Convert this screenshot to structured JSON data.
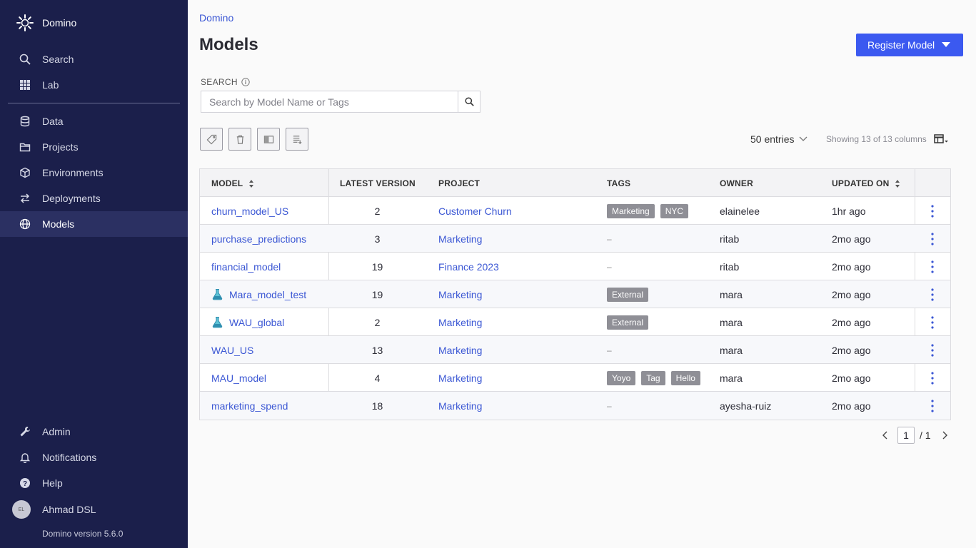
{
  "app": {
    "brand_name": "Domino",
    "version_text": "Domino version 5.6.0"
  },
  "sidebar": {
    "top_items": [
      {
        "label": "Search",
        "icon": "search-icon"
      },
      {
        "label": "Lab",
        "icon": "grid-icon"
      }
    ],
    "main_items": [
      {
        "label": "Data",
        "icon": "database-icon"
      },
      {
        "label": "Projects",
        "icon": "folder-icon"
      },
      {
        "label": "Environments",
        "icon": "cube-icon"
      },
      {
        "label": "Deployments",
        "icon": "arrows-icon"
      },
      {
        "label": "Models",
        "icon": "globe-icon",
        "active": true
      }
    ],
    "bottom_items": [
      {
        "label": "Admin",
        "icon": "wrench-icon"
      },
      {
        "label": "Notifications",
        "icon": "bell-icon"
      },
      {
        "label": "Help",
        "icon": "help-icon"
      }
    ],
    "user": {
      "initials": "EL",
      "name": "Ahmad DSL"
    }
  },
  "header": {
    "breadcrumb": "Domino",
    "title": "Models",
    "register_button": "Register Model"
  },
  "search": {
    "label": "SEARCH",
    "placeholder": "Search by Model Name or Tags"
  },
  "toolbar": {
    "entries": "50 entries",
    "showing": "Showing 13 of 13 columns"
  },
  "table": {
    "columns": [
      "MODEL",
      "LATEST VERSION",
      "PROJECT",
      "TAGS",
      "OWNER",
      "UPDATED ON"
    ],
    "rows": [
      {
        "model": "churn_model_US",
        "version": "2",
        "project": "Customer Churn",
        "tags": [
          "Marketing",
          "NYC"
        ],
        "owner": "elainelee",
        "updated": "1hr ago",
        "experiment": false
      },
      {
        "model": "purchase_predictions",
        "version": "3",
        "project": "Marketing",
        "tags": [],
        "owner": "ritab",
        "updated": "2mo ago",
        "experiment": false
      },
      {
        "model": "financial_model",
        "version": "19",
        "project": "Finance 2023",
        "tags": [],
        "owner": "ritab",
        "updated": "2mo ago",
        "experiment": false
      },
      {
        "model": "Mara_model_test",
        "version": "19",
        "project": "Marketing",
        "tags": [
          "External"
        ],
        "owner": "mara",
        "updated": "2mo ago",
        "experiment": true
      },
      {
        "model": "WAU_global",
        "version": "2",
        "project": "Marketing",
        "tags": [
          "External"
        ],
        "owner": "mara",
        "updated": "2mo ago",
        "experiment": true
      },
      {
        "model": "WAU_US",
        "version": "13",
        "project": "Marketing",
        "tags": [],
        "owner": "mara",
        "updated": "2mo ago",
        "experiment": false
      },
      {
        "model": "MAU_model",
        "version": "4",
        "project": "Marketing",
        "tags": [
          "Yoyo",
          "Tag",
          "Hello"
        ],
        "owner": "mara",
        "updated": "2mo ago",
        "experiment": false
      },
      {
        "model": "marketing_spend",
        "version": "18",
        "project": "Marketing",
        "tags": [],
        "owner": "ayesha-ruiz",
        "updated": "2mo ago",
        "experiment": false
      }
    ],
    "empty_tag": "–"
  },
  "pagination": {
    "current": "1",
    "total": "/ 1"
  },
  "colors": {
    "sidebar_bg": "#1b1f4b",
    "accent": "#3b59f0",
    "link": "#3b57d4"
  }
}
